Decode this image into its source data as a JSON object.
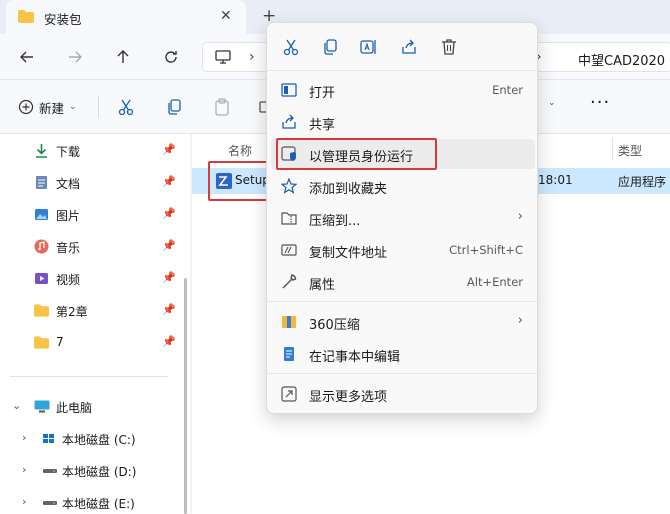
{
  "tab": {
    "title": "安装包",
    "close": "✕",
    "add": "+"
  },
  "address": {
    "crumb": "中望CAD2020",
    "chevron": "›"
  },
  "toolbar": {
    "new_label": "新建",
    "more": "···"
  },
  "sidebar": {
    "quick": [
      {
        "label": "下载",
        "icon": "download-icon"
      },
      {
        "label": "文档",
        "icon": "document-icon"
      },
      {
        "label": "图片",
        "icon": "pictures-icon"
      },
      {
        "label": "音乐",
        "icon": "music-icon"
      },
      {
        "label": "视频",
        "icon": "video-icon"
      },
      {
        "label": "第2章",
        "icon": "folder-icon"
      },
      {
        "label": "7",
        "icon": "folder-icon"
      }
    ],
    "pc": {
      "label": "此电脑"
    },
    "drives": [
      {
        "label": "本地磁盘 (C:)"
      },
      {
        "label": "本地磁盘 (D:)"
      },
      {
        "label": "本地磁盘 (E:)"
      }
    ]
  },
  "main": {
    "col_name": "名称",
    "col_type": "类型",
    "file": {
      "name": "Setup",
      "time": "18:01",
      "type": "应用程序"
    }
  },
  "context_menu": {
    "items": [
      {
        "label": "打开",
        "shortcut": "Enter"
      },
      {
        "label": "共享",
        "shortcut": ""
      },
      {
        "label": "以管理员身份运行",
        "shortcut": ""
      },
      {
        "label": "添加到收藏夹",
        "shortcut": ""
      },
      {
        "label": "压缩到...",
        "shortcut": ""
      },
      {
        "label": "复制文件地址",
        "shortcut": "Ctrl+Shift+C"
      },
      {
        "label": "属性",
        "shortcut": "Alt+Enter"
      },
      {
        "label": "360压缩",
        "shortcut": ""
      },
      {
        "label": "在记事本中编辑",
        "shortcut": ""
      },
      {
        "label": "显示更多选项",
        "shortcut": ""
      }
    ]
  },
  "colors": {
    "accent": "#0067c0",
    "highlight_red": "#d63b3b",
    "selected_row": "#cce8ff",
    "folder": "#f8c444"
  }
}
